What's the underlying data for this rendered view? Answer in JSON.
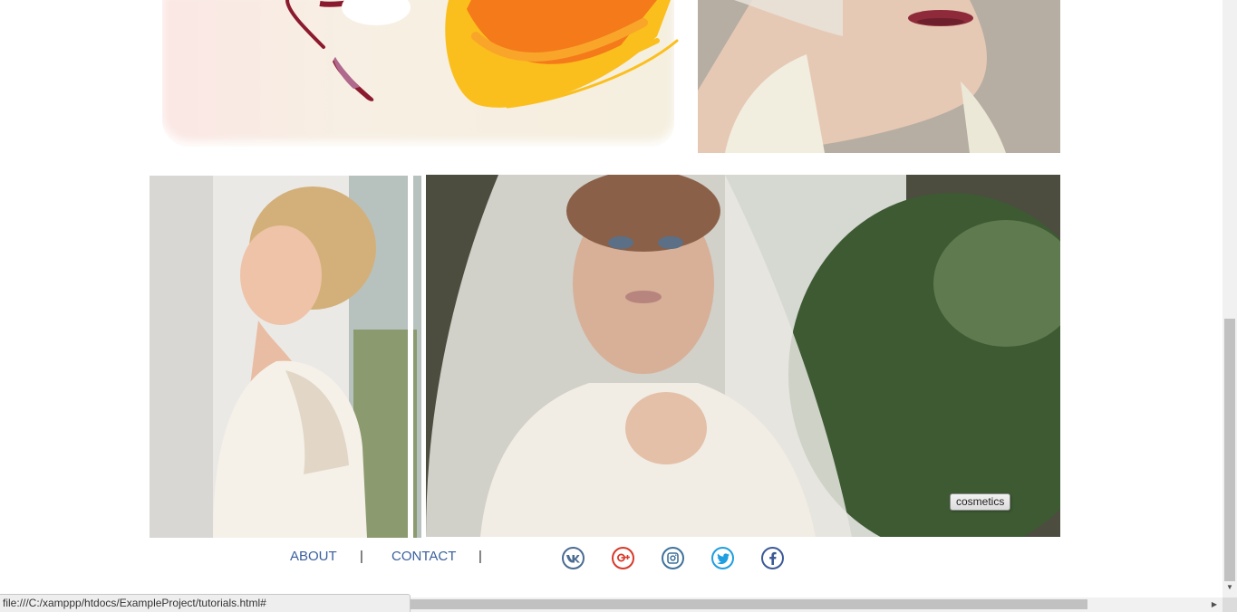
{
  "gallery": {
    "art_tile_colors": {
      "wine": "#8b1a2e",
      "orange": "#f47a1a",
      "yellow": "#fbbf1d"
    },
    "tooltip": "cosmetics"
  },
  "footer": {
    "nav": [
      {
        "label": "ABOUT"
      },
      {
        "label": "CONTACT"
      }
    ],
    "separator": "|",
    "social": [
      {
        "icon": "vk-icon",
        "color": "#4a6b93"
      },
      {
        "icon": "google-plus-icon",
        "color": "#d8392b"
      },
      {
        "icon": "instagram-icon",
        "color": "#3f729b"
      },
      {
        "icon": "twitter-icon",
        "color": "#1f9ee0"
      },
      {
        "icon": "facebook-icon",
        "color": "#3b5998"
      }
    ]
  },
  "status_bar": {
    "url": "file:///C:/xamppp/htdocs/ExampleProject/tutorials.html#"
  }
}
